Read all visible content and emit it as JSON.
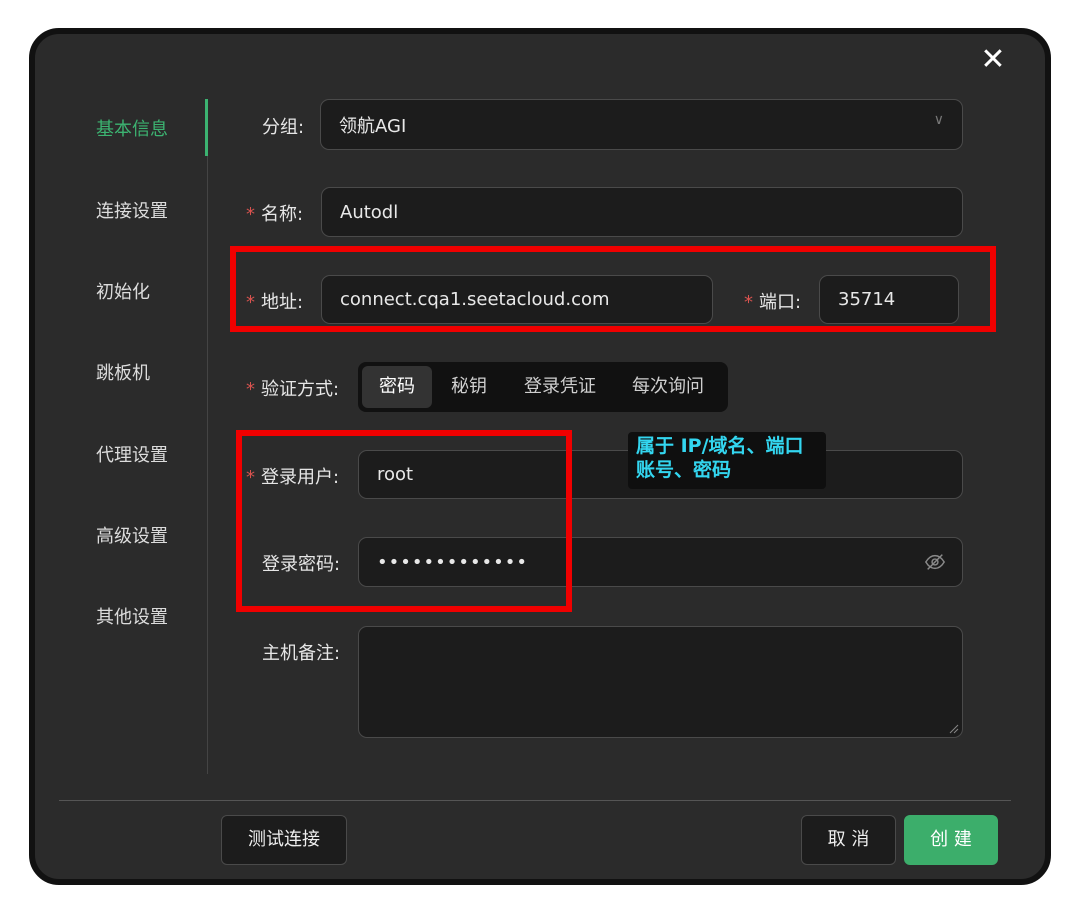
{
  "dialog": {
    "close_label": "✕"
  },
  "sidebar": {
    "items": [
      {
        "label": "基本信息"
      },
      {
        "label": "连接设置"
      },
      {
        "label": "初始化"
      },
      {
        "label": "跳板机"
      },
      {
        "label": "代理设置"
      },
      {
        "label": "高级设置"
      },
      {
        "label": "其他设置"
      }
    ]
  },
  "form": {
    "group": {
      "label": "分组:",
      "value": "领航AGI"
    },
    "name": {
      "required_mark": "*",
      "label": "名称:",
      "value": "Autodl"
    },
    "address": {
      "required_mark": "*",
      "label": "地址:",
      "value": "connect.cqa1.seetacloud.com"
    },
    "port": {
      "required_mark": "*",
      "label": "端口:",
      "value": "35714"
    },
    "auth": {
      "required_mark": "*",
      "label": "验证方式:",
      "options": [
        "密码",
        "秘钥",
        "登录凭证",
        "每次询问"
      ],
      "selected": "密码"
    },
    "username": {
      "required_mark": "*",
      "label": "登录用户:",
      "value": "root"
    },
    "password": {
      "label": "登录密码:",
      "value": "•••••••••••••"
    },
    "note": {
      "label": "主机备注:",
      "value": ""
    }
  },
  "annotation": {
    "line1": "属于 IP/域名、端口",
    "line2": "账号、密码",
    "box_color": "#f00000",
    "text_color": "#33d6f0"
  },
  "footer": {
    "test_label": "测试连接",
    "cancel_label": "取 消",
    "create_label": "创 建"
  },
  "colors": {
    "accent": "#3cb371",
    "background": "#2b2b2b",
    "required": "#d9534f"
  }
}
